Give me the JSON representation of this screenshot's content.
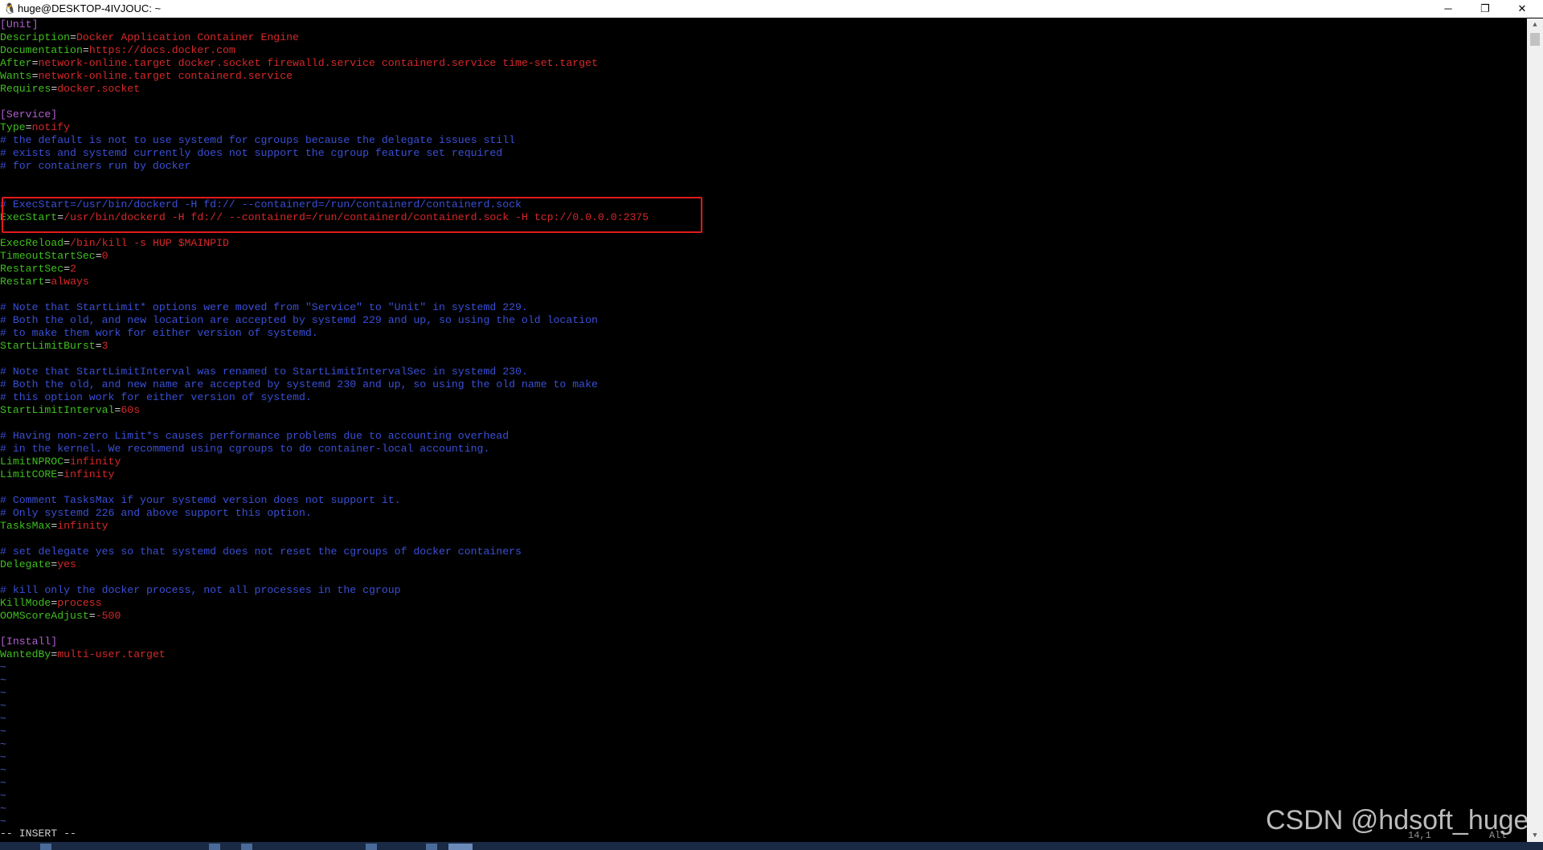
{
  "window": {
    "title": "huge@DESKTOP-4IVJOUC: ~",
    "controls": {
      "minimize": "─",
      "restore": "❐",
      "close": "✕"
    }
  },
  "colors": {
    "section": "#b05fd1",
    "key": "#3fbf1f",
    "value": "#d62828",
    "comment": "#3a4fd6",
    "highlight_box": "#e21b1b"
  },
  "editor": {
    "lines": [
      [
        {
          "t": "[Unit]",
          "c": "purple"
        }
      ],
      [
        {
          "t": "Description",
          "c": "green"
        },
        {
          "t": "=",
          "c": "white"
        },
        {
          "t": "Docker Application Container Engine",
          "c": "red"
        }
      ],
      [
        {
          "t": "Documentation",
          "c": "green"
        },
        {
          "t": "=",
          "c": "white"
        },
        {
          "t": "https://docs.docker.com",
          "c": "red"
        }
      ],
      [
        {
          "t": "After",
          "c": "green"
        },
        {
          "t": "=",
          "c": "white"
        },
        {
          "t": "network-online.target docker.socket firewalld.service containerd.service time-set.target",
          "c": "red"
        }
      ],
      [
        {
          "t": "Wants",
          "c": "green"
        },
        {
          "t": "=",
          "c": "white"
        },
        {
          "t": "network-online.target containerd.service",
          "c": "red"
        }
      ],
      [
        {
          "t": "Requires",
          "c": "green"
        },
        {
          "t": "=",
          "c": "white"
        },
        {
          "t": "docker.socket",
          "c": "red"
        }
      ],
      [],
      [
        {
          "t": "[Service]",
          "c": "purple"
        }
      ],
      [
        {
          "t": "Type",
          "c": "green"
        },
        {
          "t": "=",
          "c": "white"
        },
        {
          "t": "notify",
          "c": "red"
        }
      ],
      [
        {
          "t": "# the default is not to use systemd for cgroups because the delegate issues still",
          "c": "blue"
        }
      ],
      [
        {
          "t": "# exists and systemd currently does not support the cgroup feature set required",
          "c": "blue"
        }
      ],
      [
        {
          "t": "# for containers run by docker",
          "c": "blue"
        }
      ],
      [],
      [],
      [
        {
          "t": "# ExecStart=/usr/bin/dockerd -H fd:// --containerd=/run/containerd/containerd.sock",
          "c": "blue"
        }
      ],
      [
        {
          "t": "ExecStart",
          "c": "green"
        },
        {
          "t": "=",
          "c": "white"
        },
        {
          "t": "/usr/bin/dockerd -H fd:// --containerd=/run/containerd/containerd.sock -H tcp://0.0.0.0:2375",
          "c": "red"
        }
      ],
      [],
      [
        {
          "t": "ExecReload",
          "c": "green"
        },
        {
          "t": "=",
          "c": "white"
        },
        {
          "t": "/bin/kill -s HUP $MAINPID",
          "c": "red"
        }
      ],
      [
        {
          "t": "TimeoutStartSec",
          "c": "green"
        },
        {
          "t": "=",
          "c": "white"
        },
        {
          "t": "0",
          "c": "red"
        }
      ],
      [
        {
          "t": "RestartSec",
          "c": "green"
        },
        {
          "t": "=",
          "c": "white"
        },
        {
          "t": "2",
          "c": "red"
        }
      ],
      [
        {
          "t": "Restart",
          "c": "green"
        },
        {
          "t": "=",
          "c": "white"
        },
        {
          "t": "always",
          "c": "red"
        }
      ],
      [],
      [
        {
          "t": "# Note that StartLimit* options were moved from \"Service\" to \"Unit\" in systemd 229.",
          "c": "blue"
        }
      ],
      [
        {
          "t": "# Both the old, and new location are accepted by systemd 229 and up, so using the old location",
          "c": "blue"
        }
      ],
      [
        {
          "t": "# to make them work for either version of systemd.",
          "c": "blue"
        }
      ],
      [
        {
          "t": "StartLimitBurst",
          "c": "green"
        },
        {
          "t": "=",
          "c": "white"
        },
        {
          "t": "3",
          "c": "red"
        }
      ],
      [],
      [
        {
          "t": "# Note that StartLimitInterval was renamed to StartLimitIntervalSec in systemd 230.",
          "c": "blue"
        }
      ],
      [
        {
          "t": "# Both the old, and new name are accepted by systemd 230 and up, so using the old name to make",
          "c": "blue"
        }
      ],
      [
        {
          "t": "# this option work for either version of systemd.",
          "c": "blue"
        }
      ],
      [
        {
          "t": "StartLimitInterval",
          "c": "green"
        },
        {
          "t": "=",
          "c": "white"
        },
        {
          "t": "60s",
          "c": "red"
        }
      ],
      [],
      [
        {
          "t": "# Having non-zero Limit*s causes performance problems due to accounting overhead",
          "c": "blue"
        }
      ],
      [
        {
          "t": "# in the kernel. We recommend using cgroups to do container-local accounting.",
          "c": "blue"
        }
      ],
      [
        {
          "t": "LimitNPROC",
          "c": "green"
        },
        {
          "t": "=",
          "c": "white"
        },
        {
          "t": "infinity",
          "c": "red"
        }
      ],
      [
        {
          "t": "LimitCORE",
          "c": "green"
        },
        {
          "t": "=",
          "c": "white"
        },
        {
          "t": "infinity",
          "c": "red"
        }
      ],
      [],
      [
        {
          "t": "# Comment TasksMax if your systemd version does not support it.",
          "c": "blue"
        }
      ],
      [
        {
          "t": "# Only systemd 226 and above support this option.",
          "c": "blue"
        }
      ],
      [
        {
          "t": "TasksMax",
          "c": "green"
        },
        {
          "t": "=",
          "c": "white"
        },
        {
          "t": "infinity",
          "c": "red"
        }
      ],
      [],
      [
        {
          "t": "# set delegate yes so that systemd does not reset the cgroups of docker containers",
          "c": "blue"
        }
      ],
      [
        {
          "t": "Delegate",
          "c": "green"
        },
        {
          "t": "=",
          "c": "white"
        },
        {
          "t": "yes",
          "c": "red"
        }
      ],
      [],
      [
        {
          "t": "# kill only the docker process, not all processes in the cgroup",
          "c": "blue"
        }
      ],
      [
        {
          "t": "KillMode",
          "c": "green"
        },
        {
          "t": "=",
          "c": "white"
        },
        {
          "t": "process",
          "c": "red"
        }
      ],
      [
        {
          "t": "OOMScoreAdjust",
          "c": "green"
        },
        {
          "t": "=",
          "c": "white"
        },
        {
          "t": "-500",
          "c": "red"
        }
      ],
      [],
      [
        {
          "t": "[Install]",
          "c": "purple"
        }
      ],
      [
        {
          "t": "WantedBy",
          "c": "green"
        },
        {
          "t": "=",
          "c": "white"
        },
        {
          "t": "multi-user.target",
          "c": "red"
        }
      ],
      [
        {
          "t": "~",
          "c": "tilde"
        }
      ],
      [
        {
          "t": "~",
          "c": "tilde"
        }
      ],
      [
        {
          "t": "~",
          "c": "tilde"
        }
      ],
      [
        {
          "t": "~",
          "c": "tilde"
        }
      ],
      [
        {
          "t": "~",
          "c": "tilde"
        }
      ],
      [
        {
          "t": "~",
          "c": "tilde"
        }
      ],
      [
        {
          "t": "~",
          "c": "tilde"
        }
      ],
      [
        {
          "t": "~",
          "c": "tilde"
        }
      ],
      [
        {
          "t": "~",
          "c": "tilde"
        }
      ],
      [
        {
          "t": "~",
          "c": "tilde"
        }
      ],
      [
        {
          "t": "~",
          "c": "tilde"
        }
      ],
      [
        {
          "t": "~",
          "c": "tilde"
        }
      ],
      [
        {
          "t": "~",
          "c": "tilde"
        }
      ]
    ]
  },
  "status": {
    "mode": "-- INSERT --",
    "cursor_position": "14,1",
    "scroll_position": "All"
  },
  "watermark": "CSDN @hdsoft_huge"
}
